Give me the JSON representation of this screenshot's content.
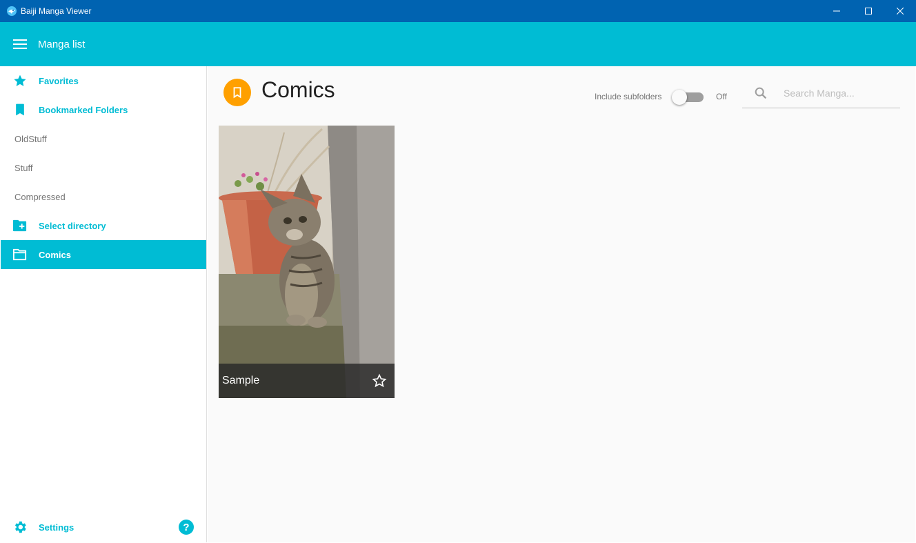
{
  "window": {
    "title": "Baiji Manga Viewer",
    "controls": [
      "minimize",
      "maximize",
      "close"
    ]
  },
  "appbar": {
    "title": "Manga list",
    "color": "#00bcd4"
  },
  "sidebar": {
    "items": [
      {
        "label": "Favorites",
        "icon": "star-icon",
        "style": "primary"
      },
      {
        "label": "Bookmarked Folders",
        "icon": "bookmark-icon",
        "style": "primary"
      },
      {
        "label": "OldStuff",
        "style": "plain"
      },
      {
        "label": "Stuff",
        "style": "plain"
      },
      {
        "label": "Compressed",
        "style": "plain"
      },
      {
        "label": "Select directory",
        "icon": "folder-add-icon",
        "style": "primary"
      },
      {
        "label": "Comics",
        "icon": "folder-icon",
        "style": "active"
      }
    ],
    "footer": {
      "settings_label": "Settings",
      "help_label": "?"
    }
  },
  "main": {
    "title": "Comics",
    "badge_icon": "bookmark-icon",
    "badge_color": "#ffa000",
    "subfolders": {
      "label": "Include subfolders",
      "state": "Off",
      "enabled": false
    },
    "search": {
      "placeholder": "Search Manga...",
      "value": ""
    },
    "manga": [
      {
        "title": "Sample",
        "favorite": false,
        "cover": "kitten-photo"
      }
    ]
  }
}
